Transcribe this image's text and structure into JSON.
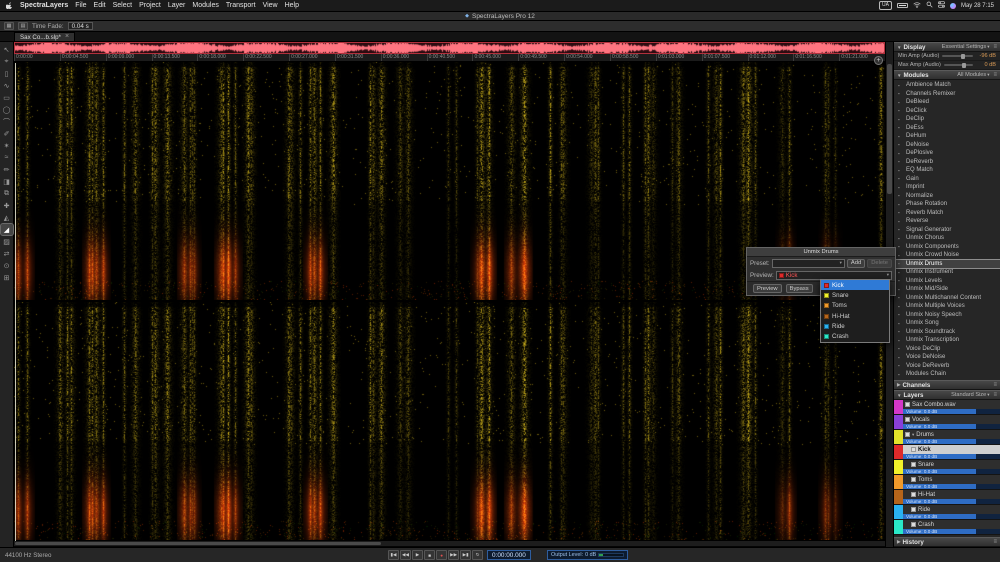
{
  "menu_bar": {
    "app_name": "SpectraLayers",
    "items": [
      "File",
      "Edit",
      "Select",
      "Project",
      "Layer",
      "Modules",
      "Transport",
      "View",
      "Help"
    ],
    "status": {
      "keyboard_badge": "UA",
      "clock": "May 28 7:15"
    }
  },
  "window": {
    "title": "SpectraLayers Pro 12"
  },
  "toolbar": {
    "time_fade_label": "Time Fade:",
    "time_fade_value": "0.04 s"
  },
  "tab": {
    "label": "Sax Co...b.slp*",
    "close_glyph": "×"
  },
  "tools": [
    {
      "name": "pointer-tool",
      "glyph": "↖"
    },
    {
      "name": "transform-tool",
      "glyph": "⌖"
    },
    {
      "name": "time-selection-tool",
      "glyph": "▯"
    },
    {
      "name": "frequency-selection-tool",
      "glyph": "∿"
    },
    {
      "name": "rectangle-selection-tool",
      "glyph": "▭"
    },
    {
      "name": "ellipse-selection-tool",
      "glyph": "◯"
    },
    {
      "name": "lasso-selection-tool",
      "glyph": "⌒"
    },
    {
      "name": "brush-selection-tool",
      "glyph": "✐"
    },
    {
      "name": "magic-wand-tool",
      "glyph": "✶"
    },
    {
      "name": "find-similar-tool",
      "glyph": "≈"
    },
    {
      "name": "draw-tool",
      "glyph": "✏"
    },
    {
      "name": "erase-tool",
      "glyph": "◨"
    },
    {
      "name": "clone-tool",
      "glyph": "⧉"
    },
    {
      "name": "heal-tool",
      "glyph": "✚"
    },
    {
      "name": "amplify-tool",
      "glyph": "◭"
    },
    {
      "name": "fade-tool",
      "glyph": "◢",
      "active": true
    },
    {
      "name": "blur-tool",
      "glyph": "▨"
    },
    {
      "name": "move-tool",
      "glyph": "⇄"
    },
    {
      "name": "zoom-tool",
      "glyph": "⊙"
    },
    {
      "name": "pan-tool",
      "glyph": "⊞"
    }
  ],
  "timeline": {
    "labels": [
      "0:00:00",
      "0:00:04.500",
      "0:00:09.000",
      "0:00:13.500",
      "0:00:18.000",
      "0:00:22.500",
      "0:00:27.000",
      "0:00:31.500",
      "0:00:36.000",
      "0:00:40.500",
      "0:00:45.000",
      "0:00:49.500",
      "0:00:54.000",
      "0:00:58.500",
      "0:01:03.000",
      "0:01:07.500",
      "0:01:12.000",
      "0:01:16.500",
      "0:01:21.000"
    ]
  },
  "spectrogram": {
    "channels": [
      "left",
      "right"
    ],
    "palette": {
      "background": "#060603",
      "energy_yellow": "#e0c020",
      "energy_red": "#ff3010",
      "overview_bg": "#2c0b10",
      "overview_wave": "#ff7480"
    }
  },
  "dialog": {
    "title": "Unmix Drums",
    "preset_label": "Preset:",
    "preset_value": "",
    "add_button": "Add",
    "delete_button": "Delete",
    "preview_label": "Preview:",
    "component_value": "Kick",
    "preview_button": "Preview",
    "bypass_button": "Bypass",
    "components": [
      {
        "label": "Kick",
        "color": "#e02a2a",
        "state": "hover"
      },
      {
        "label": "Snare",
        "color": "#f0f02a"
      },
      {
        "label": "Toms",
        "color": "#f0992a"
      },
      {
        "label": "Hi-Hat",
        "color": "#b5641a"
      },
      {
        "label": "Ride",
        "color": "#2ab2f0"
      },
      {
        "label": "Crash",
        "color": "#2ae8c8"
      }
    ]
  },
  "right_panel": {
    "display": {
      "title": "Display",
      "mode": "Essential Settings",
      "rows": [
        {
          "label": "Min Amp (Audio)",
          "value": "-96 dB"
        },
        {
          "label": "Max Amp (Audio)",
          "value": "0 dB"
        }
      ]
    },
    "modules": {
      "title": "Modules",
      "mode": "All Modules",
      "selected": "Unmix Drums",
      "items": [
        "Ambience Match",
        "Channels Remixer",
        "DeBleed",
        "DeClick",
        "DeClip",
        "DeEss",
        "DeHum",
        "DeNoise",
        "DePlosive",
        "DeReverb",
        "EQ Match",
        "Gain",
        "Imprint",
        "Normalize",
        "Phase Rotation",
        "Reverb Match",
        "Reverse",
        "Signal Generator",
        "Unmix Chorus",
        "Unmix Components",
        "Unmix Crowd Noise",
        "Unmix Drums",
        "Unmix Instrument",
        "Unmix Levels",
        "Unmix Mid/Side",
        "Unmix Multichannel Content",
        "Unmix Multiple Voices",
        "Unmix Noisy Speech",
        "Unmix Song",
        "Unmix Soundtrack",
        "Unmix Transcription",
        "Voice DeClip",
        "Voice DeNoise",
        "Voice DeReverb",
        "Modules Chain"
      ]
    },
    "channels": {
      "title": "Channels"
    },
    "layers": {
      "title": "Layers",
      "mode": "Standard Size",
      "items": [
        {
          "name": "Sax Combo.wav",
          "color": "#d437c8",
          "indent": 0,
          "selected": false,
          "group": false,
          "volume_label": "Volume: 0.0 dB",
          "volume_fill": 0.75
        },
        {
          "name": "Vocals",
          "color": "#8a3fd8",
          "indent": 0,
          "selected": false,
          "group": false,
          "volume_label": "Volume: 0.0 dB",
          "volume_fill": 0.75
        },
        {
          "name": "Drums",
          "color": "#e3e32a",
          "indent": 0,
          "selected": false,
          "group": true,
          "volume_label": "Volume: 0.0 dB",
          "volume_fill": 0.75
        },
        {
          "name": "Kick",
          "color": "#e02a2a",
          "indent": 1,
          "selected": true,
          "group": false,
          "volume_label": "Volume: 0.0 dB",
          "volume_fill": 0.75
        },
        {
          "name": "Snare",
          "color": "#f0f02a",
          "indent": 1,
          "selected": false,
          "group": false,
          "volume_label": "Volume: 0.0 dB",
          "volume_fill": 0.75
        },
        {
          "name": "Toms",
          "color": "#f0992a",
          "indent": 1,
          "selected": false,
          "group": false,
          "volume_label": "Volume: 0.0 dB",
          "volume_fill": 0.75
        },
        {
          "name": "Hi-Hat",
          "color": "#b5641a",
          "indent": 1,
          "selected": false,
          "group": false,
          "volume_label": "Volume: 0.0 dB",
          "volume_fill": 0.75
        },
        {
          "name": "Ride",
          "color": "#2ab2f0",
          "indent": 1,
          "selected": false,
          "group": false,
          "volume_label": "Volume: 0.0 dB",
          "volume_fill": 0.75
        },
        {
          "name": "Crash",
          "color": "#2ae8c8",
          "indent": 1,
          "selected": false,
          "group": false,
          "volume_label": "Volume: 0.0 dB",
          "volume_fill": 0.75
        }
      ]
    },
    "history": {
      "title": "History"
    }
  },
  "status_bar": {
    "sample_rate": "44100 Hz Stereo",
    "time": "0:00:00.000",
    "output_label": "Output Level:",
    "output_value": "0 dB",
    "transport": [
      {
        "name": "jump-start-button",
        "glyph": "▮◀"
      },
      {
        "name": "rewind-button",
        "glyph": "◀◀"
      },
      {
        "name": "play-button",
        "glyph": "▶"
      },
      {
        "name": "stop-button",
        "glyph": "■"
      },
      {
        "name": "record-button",
        "glyph": "●",
        "color": "#e05050"
      },
      {
        "name": "forward-button",
        "glyph": "▶▶"
      },
      {
        "name": "jump-end-button",
        "glyph": "▶▮"
      },
      {
        "name": "loop-button",
        "glyph": "↻"
      }
    ]
  }
}
